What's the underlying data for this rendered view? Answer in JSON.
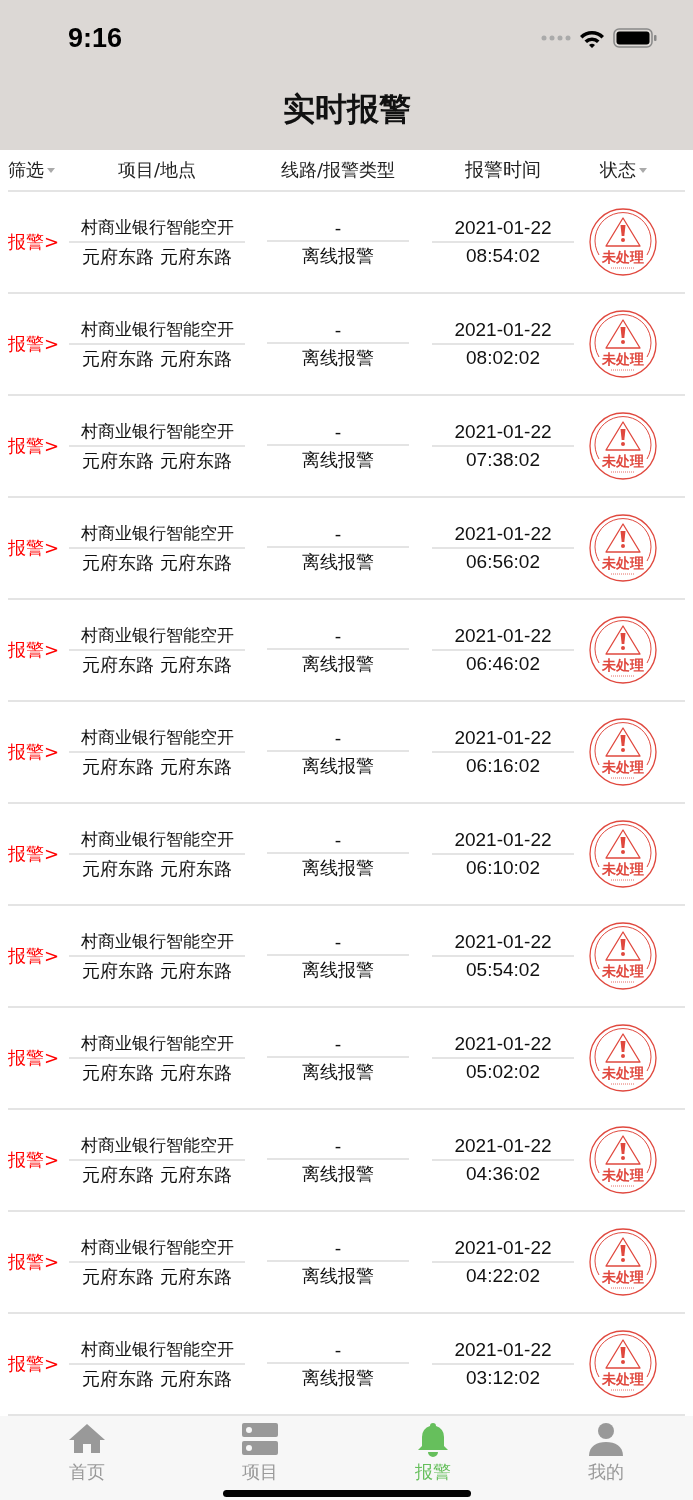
{
  "status_bar": {
    "time": "9:16"
  },
  "title": "实时报警",
  "columns": [
    {
      "label": "筛选",
      "dropdown": true
    },
    {
      "label": "项目/地点",
      "dropdown": false
    },
    {
      "label": "线路/报警类型",
      "dropdown": false
    },
    {
      "label": "报警时间",
      "dropdown": false
    },
    {
      "label": "状态",
      "dropdown": true
    }
  ],
  "rows": [
    {
      "tag": "报警>",
      "project": "村商业银行智能空开",
      "location": "元府东路 元府东路",
      "line": "-",
      "type": "离线报警",
      "date": "2021-01-22",
      "time": "08:54:02",
      "status": "未处理"
    },
    {
      "tag": "报警>",
      "project": "村商业银行智能空开",
      "location": "元府东路 元府东路",
      "line": "-",
      "type": "离线报警",
      "date": "2021-01-22",
      "time": "08:02:02",
      "status": "未处理"
    },
    {
      "tag": "报警>",
      "project": "村商业银行智能空开",
      "location": "元府东路 元府东路",
      "line": "-",
      "type": "离线报警",
      "date": "2021-01-22",
      "time": "07:38:02",
      "status": "未处理"
    },
    {
      "tag": "报警>",
      "project": "村商业银行智能空开",
      "location": "元府东路 元府东路",
      "line": "-",
      "type": "离线报警",
      "date": "2021-01-22",
      "time": "06:56:02",
      "status": "未处理"
    },
    {
      "tag": "报警>",
      "project": "村商业银行智能空开",
      "location": "元府东路 元府东路",
      "line": "-",
      "type": "离线报警",
      "date": "2021-01-22",
      "time": "06:46:02",
      "status": "未处理"
    },
    {
      "tag": "报警>",
      "project": "村商业银行智能空开",
      "location": "元府东路 元府东路",
      "line": "-",
      "type": "离线报警",
      "date": "2021-01-22",
      "time": "06:16:02",
      "status": "未处理"
    },
    {
      "tag": "报警>",
      "project": "村商业银行智能空开",
      "location": "元府东路 元府东路",
      "line": "-",
      "type": "离线报警",
      "date": "2021-01-22",
      "time": "06:10:02",
      "status": "未处理"
    },
    {
      "tag": "报警>",
      "project": "村商业银行智能空开",
      "location": "元府东路 元府东路",
      "line": "-",
      "type": "离线报警",
      "date": "2021-01-22",
      "time": "05:54:02",
      "status": "未处理"
    },
    {
      "tag": "报警>",
      "project": "村商业银行智能空开",
      "location": "元府东路 元府东路",
      "line": "-",
      "type": "离线报警",
      "date": "2021-01-22",
      "time": "05:02:02",
      "status": "未处理"
    },
    {
      "tag": "报警>",
      "project": "村商业银行智能空开",
      "location": "元府东路 元府东路",
      "line": "-",
      "type": "离线报警",
      "date": "2021-01-22",
      "time": "04:36:02",
      "status": "未处理"
    },
    {
      "tag": "报警>",
      "project": "村商业银行智能空开",
      "location": "元府东路 元府东路",
      "line": "-",
      "type": "离线报警",
      "date": "2021-01-22",
      "time": "04:22:02",
      "status": "未处理"
    },
    {
      "tag": "报警>",
      "project": "村商业银行智能空开",
      "location": "元府东路 元府东路",
      "line": "-",
      "type": "离线报警",
      "date": "2021-01-22",
      "time": "03:12:02",
      "status": "未处理"
    }
  ],
  "tab_bar": [
    {
      "label": "首页",
      "kind": "home",
      "selected": false
    },
    {
      "label": "项目",
      "kind": "project",
      "selected": false
    },
    {
      "label": "报警",
      "kind": "alarm",
      "selected": true
    },
    {
      "label": "我的",
      "kind": "me",
      "selected": false
    }
  ]
}
